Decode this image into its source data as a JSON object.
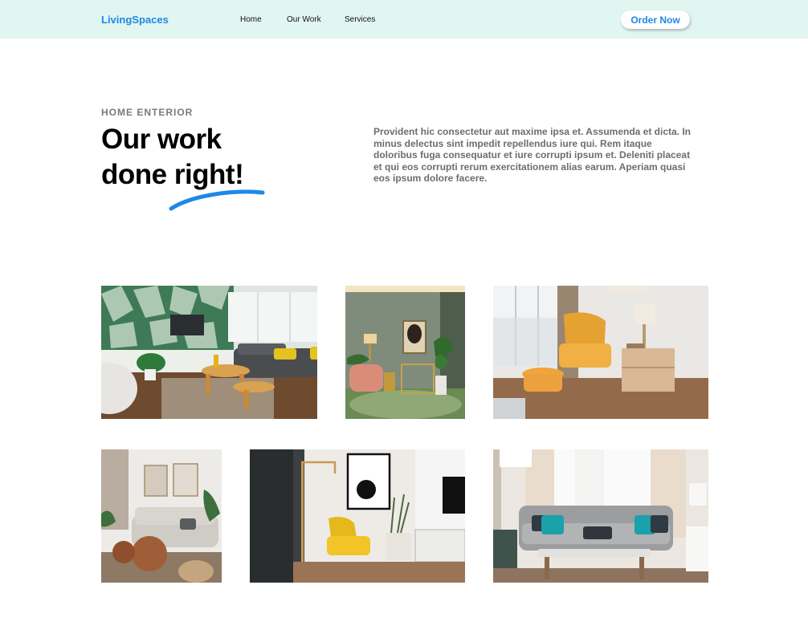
{
  "navbar": {
    "brand": "LivingSpaces",
    "links": [
      "Home",
      "Our Work",
      "Services"
    ],
    "cta_label": "Order Now"
  },
  "hero": {
    "eyebrow": "HOME ENTERIOR",
    "title_line1": "Our work",
    "title_line2": "done right!",
    "description": "Provident hic consectetur aut maxime ipsa et. Assumenda et dicta. In minus delectus sint impedit repellendus iure qui. Rem itaque doloribus fuga consequatur et iure corrupti ipsum et. Deleniti placeat et qui eos corrupti rerum exercitationem alias earum. Aperiam quasi eos ipsum dolore facere."
  },
  "colors": {
    "nav_bg": "#e1f5f1",
    "accent": "#1e88e5"
  }
}
